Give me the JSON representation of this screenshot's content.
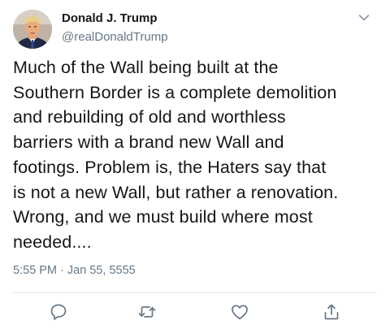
{
  "author": {
    "name": "Donald J. Trump",
    "handle": "@realDonaldTrump"
  },
  "tweet": {
    "lines": [
      "Much of the Wall being built at the",
      "Southern Border is a complete demolition",
      "and rebuilding of old and worthless",
      "barriers with a brand new Wall and",
      "footings. Problem is, the Haters say that",
      "is not a new Wall, but rather a renovation.",
      "Wrong, and we must build where most",
      "needed...."
    ],
    "timestamp": "5:55 PM · Jan 55, 5555"
  },
  "actions": {
    "reply": "reply-icon",
    "retweet": "retweet-icon",
    "like": "heart-icon",
    "share": "share-icon",
    "menu": "chevron-down-icon"
  },
  "colors": {
    "text": "#14171a",
    "muted": "#657786",
    "divider": "#e1e8ed"
  }
}
